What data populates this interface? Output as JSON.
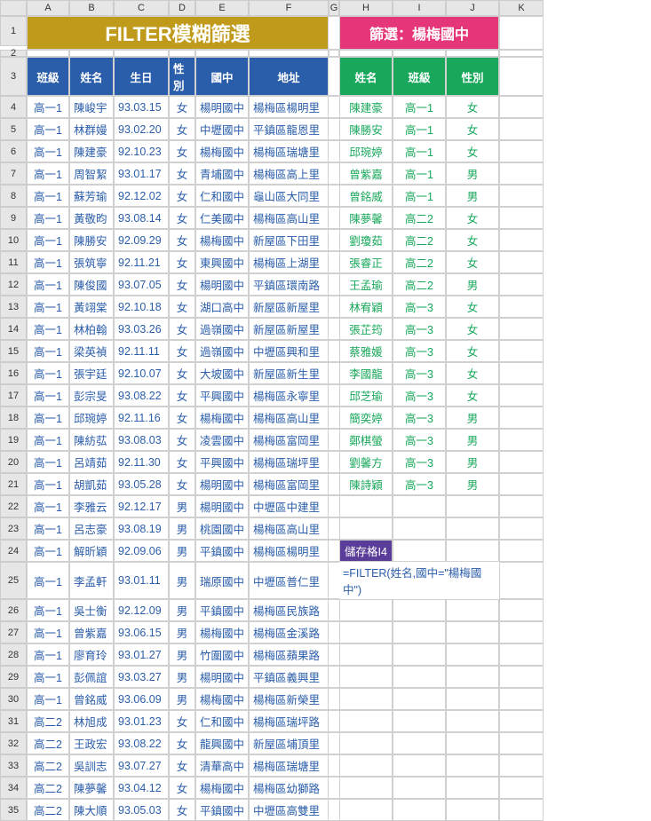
{
  "columns": [
    "",
    "A",
    "B",
    "C",
    "D",
    "E",
    "F",
    "G",
    "H",
    "I",
    "J",
    "K"
  ],
  "titleLeft": "FILTER模糊篩選",
  "titleRight": "篩選：楊梅國中",
  "leftHeaders": [
    "班級",
    "姓名",
    "生日",
    "性別",
    "國中",
    "地址"
  ],
  "rightHeaders": [
    "姓名",
    "班級",
    "性別"
  ],
  "leftData": [
    [
      "高一1",
      "陳峻宇",
      "93.03.15",
      "女",
      "楊明國中",
      "楊梅區楊明里"
    ],
    [
      "高一1",
      "林群嫚",
      "93.02.20",
      "女",
      "中壢國中",
      "平鎮區龍恩里"
    ],
    [
      "高一1",
      "陳建豪",
      "92.10.23",
      "女",
      "楊梅國中",
      "楊梅區瑞塘里"
    ],
    [
      "高一1",
      "周智絜",
      "93.01.17",
      "女",
      "青埔國中",
      "楊梅區高上里"
    ],
    [
      "高一1",
      "蘇芳瑜",
      "92.12.02",
      "女",
      "仁和國中",
      "龜山區大同里"
    ],
    [
      "高一1",
      "黃敬昀",
      "93.08.14",
      "女",
      "仁美國中",
      "楊梅區高山里"
    ],
    [
      "高一1",
      "陳勝安",
      "92.09.29",
      "女",
      "楊梅國中",
      "新屋區下田里"
    ],
    [
      "高一1",
      "張筑寧",
      "92.11.21",
      "女",
      "東興國中",
      "楊梅區上湖里"
    ],
    [
      "高一1",
      "陳俊國",
      "93.07.05",
      "女",
      "楊明國中",
      "平鎮區環南路"
    ],
    [
      "高一1",
      "黃翊棠",
      "92.10.18",
      "女",
      "湖口高中",
      "新屋區新屋里"
    ],
    [
      "高一1",
      "林柏翰",
      "93.03.26",
      "女",
      "過嶺國中",
      "新屋區新屋里"
    ],
    [
      "高一1",
      "梁英禎",
      "92.11.11",
      "女",
      "過嶺國中",
      "中壢區興和里"
    ],
    [
      "高一1",
      "張宇廷",
      "92.10.07",
      "女",
      "大坡國中",
      "新屋區新生里"
    ],
    [
      "高一1",
      "彭宗旻",
      "93.08.22",
      "女",
      "平興國中",
      "楊梅區永寧里"
    ],
    [
      "高一1",
      "邱琬婷",
      "92.11.16",
      "女",
      "楊梅國中",
      "楊梅區高山里"
    ],
    [
      "高一1",
      "陳紡苰",
      "93.08.03",
      "女",
      "凌雲國中",
      "楊梅區富岡里"
    ],
    [
      "高一1",
      "呂靖茹",
      "92.11.30",
      "女",
      "平興國中",
      "楊梅區瑞坪里"
    ],
    [
      "高一1",
      "胡凱茹",
      "93.05.28",
      "女",
      "楊明國中",
      "楊梅區富岡里"
    ],
    [
      "高一1",
      "李雅云",
      "92.12.17",
      "男",
      "楊明國中",
      "中壢區中建里"
    ],
    [
      "高一1",
      "呂志豪",
      "93.08.19",
      "男",
      "桃園國中",
      "楊梅區高山里"
    ],
    [
      "高一1",
      "解昕穎",
      "92.09.06",
      "男",
      "平鎮國中",
      "楊梅區楊明里"
    ],
    [
      "高一1",
      "李孟軒",
      "93.01.11",
      "男",
      "瑞原國中",
      "中壢區普仁里"
    ],
    [
      "高一1",
      "吳士衡",
      "92.12.09",
      "男",
      "平鎮國中",
      "楊梅區民族路"
    ],
    [
      "高一1",
      "曾紫嘉",
      "93.06.15",
      "男",
      "楊梅國中",
      "楊梅區金溪路"
    ],
    [
      "高一1",
      "廖育玲",
      "93.01.27",
      "男",
      "竹圍國中",
      "楊梅區蘋果路"
    ],
    [
      "高一1",
      "彭佩誼",
      "93.03.27",
      "男",
      "楊明國中",
      "平鎮區義興里"
    ],
    [
      "高一1",
      "曾銘威",
      "93.06.09",
      "男",
      "楊梅國中",
      "楊梅區新榮里"
    ],
    [
      "高二2",
      "林旭成",
      "93.01.23",
      "女",
      "仁和國中",
      "楊梅區瑞坪路"
    ],
    [
      "高二2",
      "王政宏",
      "93.08.22",
      "女",
      "龍興國中",
      "新屋區埔頂里"
    ],
    [
      "高二2",
      "吳訓志",
      "93.07.27",
      "女",
      "清華高中",
      "楊梅區瑞塘里"
    ],
    [
      "高二2",
      "陳夢馨",
      "93.04.12",
      "女",
      "楊梅國中",
      "楊梅區幼獅路"
    ],
    [
      "高二2",
      "陳大順",
      "93.05.03",
      "女",
      "平鎮國中",
      "中壢區高雙里"
    ]
  ],
  "rightData": [
    [
      "陳建豪",
      "高一1",
      "女"
    ],
    [
      "陳勝安",
      "高一1",
      "女"
    ],
    [
      "邱琬婷",
      "高一1",
      "女"
    ],
    [
      "曾紫嘉",
      "高一1",
      "男"
    ],
    [
      "曾銘威",
      "高一1",
      "男"
    ],
    [
      "陳夢馨",
      "高二2",
      "女"
    ],
    [
      "劉瓊茹",
      "高二2",
      "女"
    ],
    [
      "張睿正",
      "高二2",
      "女"
    ],
    [
      "王孟瑜",
      "高二2",
      "男"
    ],
    [
      "林宥穎",
      "高一3",
      "女"
    ],
    [
      "張芷筠",
      "高一3",
      "女"
    ],
    [
      "蔡雅媛",
      "高一3",
      "女"
    ],
    [
      "李國龍",
      "高一3",
      "女"
    ],
    [
      "邱芝瑜",
      "高一3",
      "女"
    ],
    [
      "簡奕婷",
      "高一3",
      "男"
    ],
    [
      "鄭棋螢",
      "高一3",
      "男"
    ],
    [
      "劉馨方",
      "高一3",
      "男"
    ],
    [
      "陳詩穎",
      "高一3",
      "男"
    ]
  ],
  "formulaLabel": "儲存格I4",
  "formulaText": "=FILTER(姓名,國中=\"楊梅國中\")"
}
